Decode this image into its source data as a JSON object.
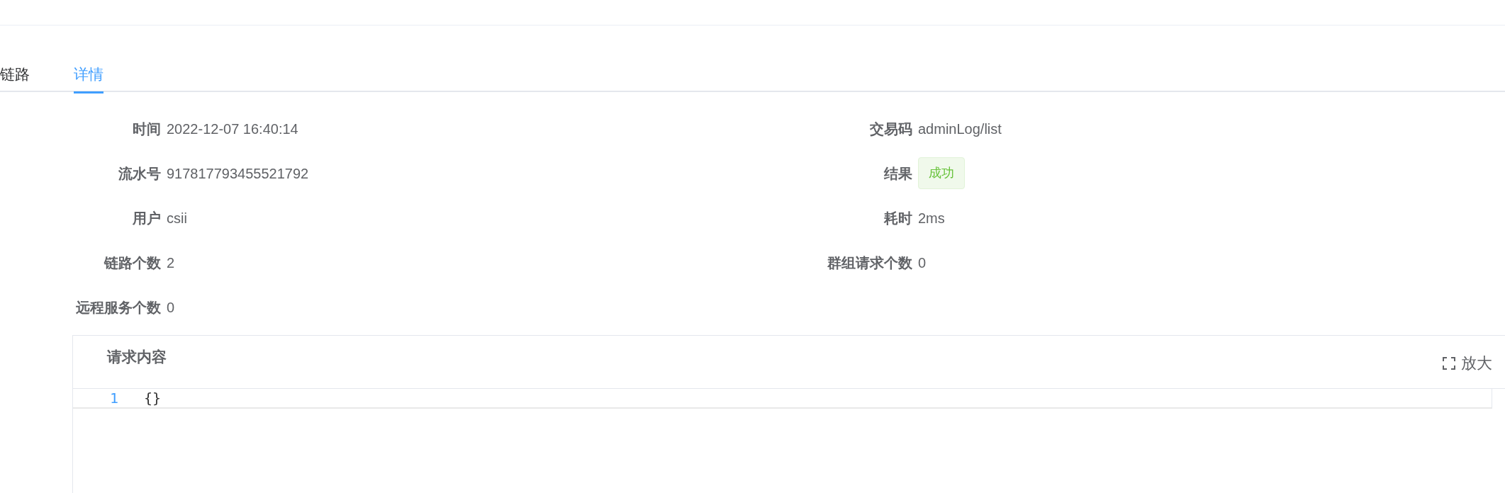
{
  "tabs": [
    {
      "label": "链路",
      "selected": false
    },
    {
      "label": "详情",
      "selected": true
    }
  ],
  "details": [
    {
      "label": "时间",
      "value": "2022-12-07 16:40:14",
      "kind": "text"
    },
    {
      "label": "交易码",
      "value": "adminLog/list",
      "kind": "text"
    },
    {
      "label": "流水号",
      "value": "917817793455521792",
      "kind": "text"
    },
    {
      "label": "结果",
      "value": "成功",
      "kind": "tag"
    },
    {
      "label": "用户",
      "value": "csii",
      "kind": "text"
    },
    {
      "label": "耗时",
      "value": "2ms",
      "kind": "text"
    },
    {
      "label": "链路个数",
      "value": "2",
      "kind": "text"
    },
    {
      "label": "群组请求个数",
      "value": "0",
      "kind": "text"
    },
    {
      "label": "远程服务个数",
      "value": "0",
      "kind": "text"
    }
  ],
  "request_panel": {
    "title": "请求内容",
    "expand_label": "放大",
    "lines": [
      {
        "number": "1",
        "code": "{}"
      }
    ]
  }
}
